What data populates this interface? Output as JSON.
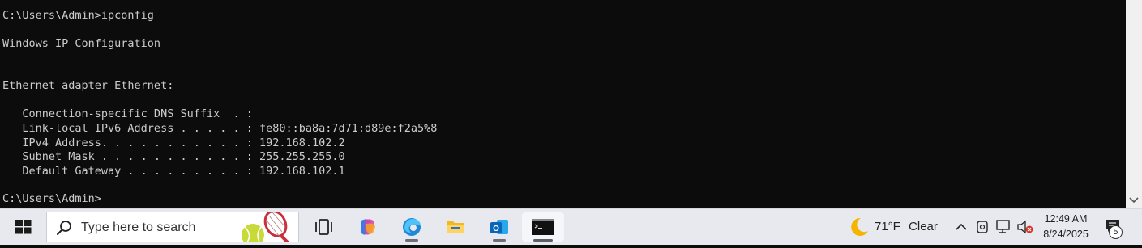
{
  "console": {
    "lines": [
      "C:\\Users\\Admin>ipconfig",
      "Windows IP Configuration",
      "Ethernet adapter Ethernet:",
      "   Connection-specific DNS Suffix  . :",
      "   Link-local IPv6 Address . . . . . : fe80::ba8a:7d71:d89e:f2a5%8",
      "   IPv4 Address. . . . . . . . . . . : 192.168.102.2",
      "   Subnet Mask . . . . . . . . . . . : 255.255.255.0",
      "   Default Gateway . . . . . . . . . : 192.168.102.1",
      "C:\\Users\\Admin>"
    ]
  },
  "taskbar": {
    "search_placeholder": "Type here to search",
    "weather": {
      "temp": "71°F",
      "condition": "Clear",
      "icon": "moon-icon"
    },
    "clock": {
      "time": "12:49 AM",
      "date": "8/24/2025"
    },
    "notifications_count": "5",
    "apps": [
      "task-view",
      "copilot",
      "edge",
      "file-explorer",
      "outlook",
      "command-prompt"
    ]
  },
  "colors": {
    "console_bg": "#0c0c0c",
    "console_text": "#cccccc",
    "taskbar_bg": "#e7e9ee"
  }
}
